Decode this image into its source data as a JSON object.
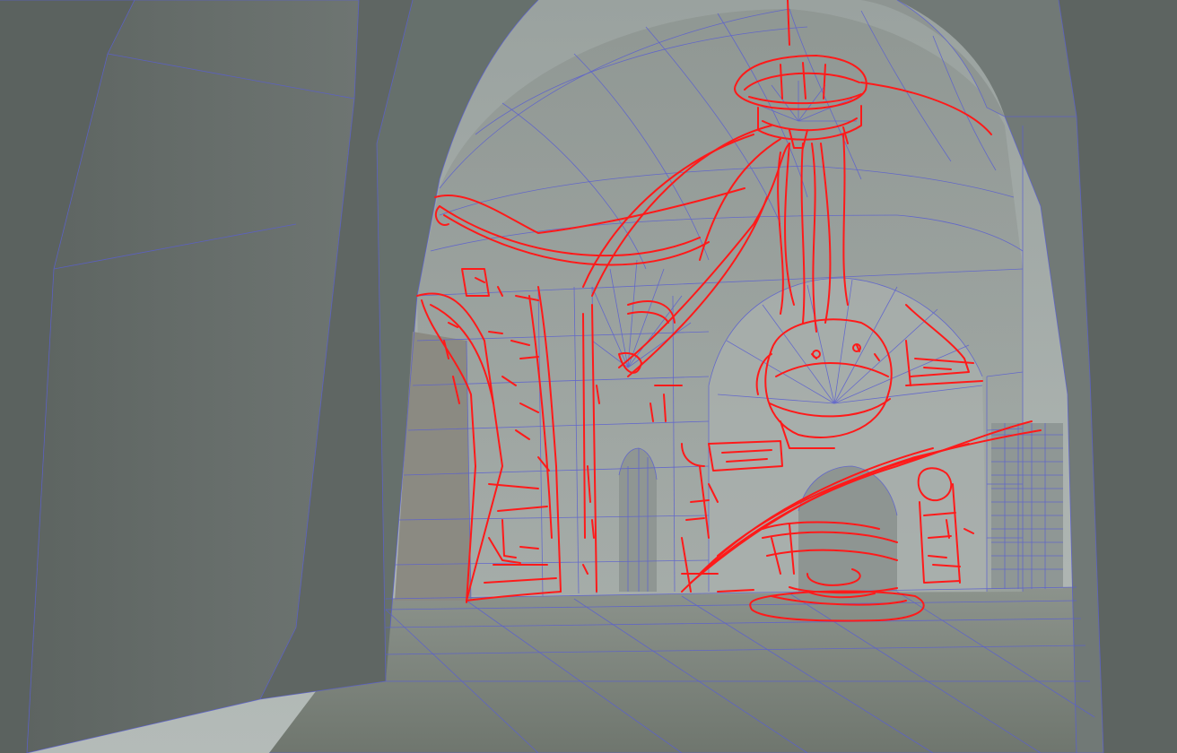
{
  "viewport": {
    "colors": {
      "wireframe": "#5a5fd0",
      "sketch": "#ff1a1a",
      "wall_dark": "#5f6663",
      "wall_mid": "#7b8380",
      "wall_light": "#a7aeab",
      "floor": "#767d74",
      "background": "#6f7572"
    }
  }
}
